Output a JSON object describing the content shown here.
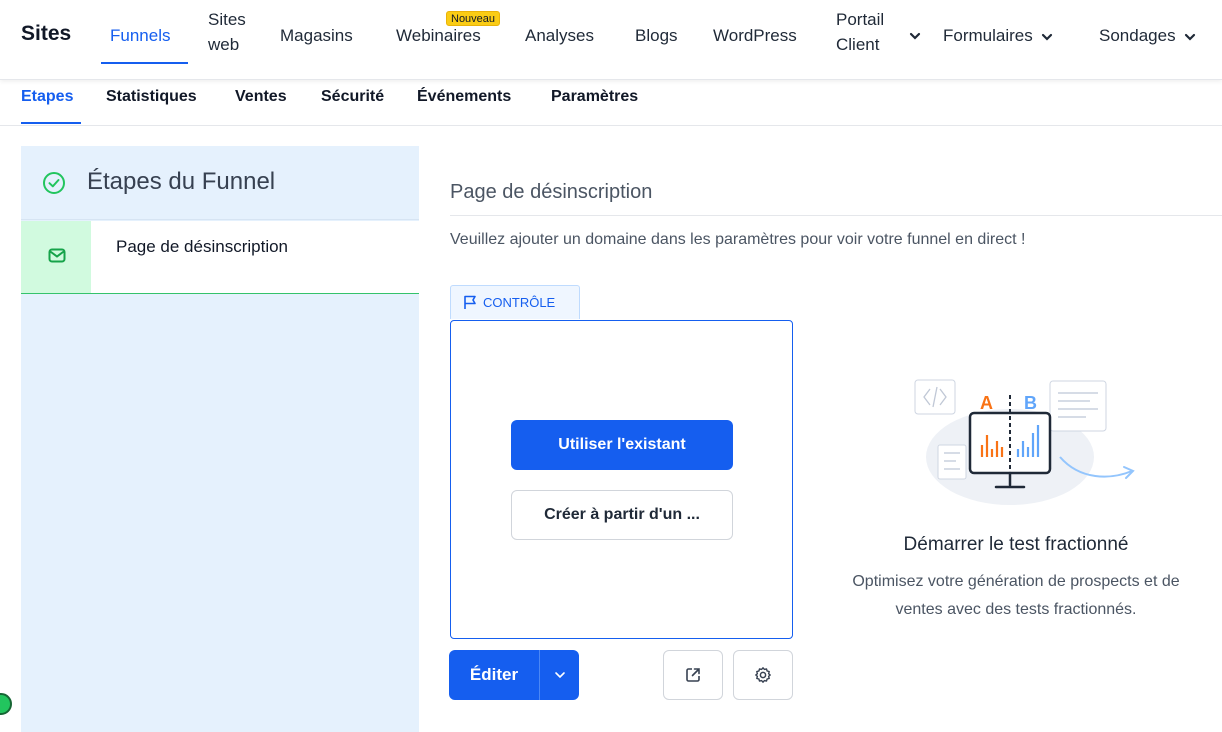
{
  "topnav": {
    "brand": "Sites",
    "items": [
      {
        "label": "Funnels"
      },
      {
        "label_l1": "Sites",
        "label_l2": "web"
      },
      {
        "label": "Magasins"
      },
      {
        "label": "Webinaires",
        "badge": "Nouveau"
      },
      {
        "label": "Analyses"
      },
      {
        "label": "Blogs"
      },
      {
        "label": "WordPress"
      },
      {
        "label_l1": "Portail",
        "label_l2": "Client"
      },
      {
        "label": "Formulaires"
      },
      {
        "label": "Sondages"
      }
    ],
    "active": "Funnels"
  },
  "subtabs": [
    "Etapes",
    "Statistiques",
    "Ventes",
    "Sécurité",
    "Événements",
    "Paramètres"
  ],
  "sidebar": {
    "title": "Étapes du Funnel",
    "steps": [
      {
        "label": "Page de désinscription",
        "icon": "mail-icon"
      }
    ]
  },
  "main": {
    "page_title": "Page de désinscription",
    "notice": "Veuillez ajouter un domaine dans les paramètres pour voir votre funnel en direct !",
    "control_tag": "CONTRÔLE",
    "use_existing": "Utiliser l'existant",
    "create_from": "Créer à partir d'un ...",
    "edit": "Éditer"
  },
  "split_test": {
    "label_a": "A",
    "label_b": "B",
    "title": "Démarrer le test fractionné",
    "desc_l1": "Optimisez votre génération de prospects et de",
    "desc_l2": "ventes avec des tests fractionnés."
  },
  "colors": {
    "accent": "#155eef",
    "success": "#22c55e",
    "badge": "#facc15",
    "panel": "#e5f1fd"
  }
}
